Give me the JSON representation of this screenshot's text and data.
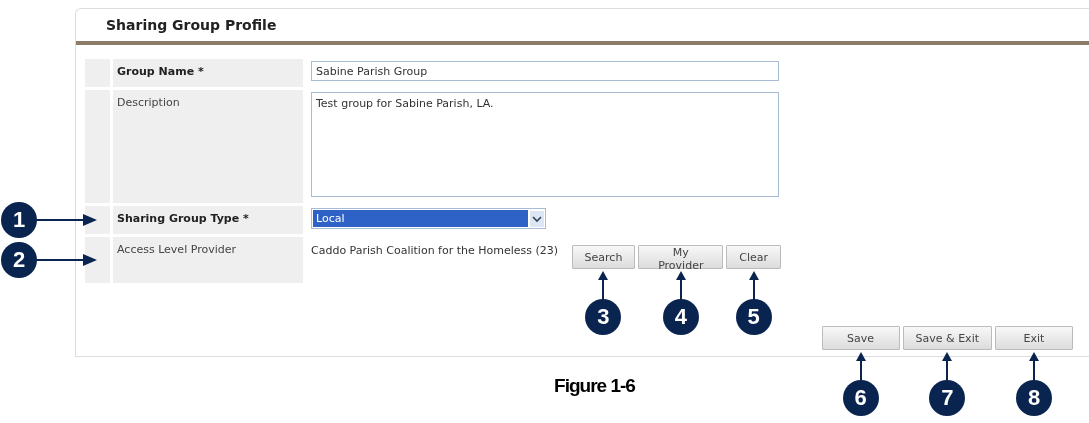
{
  "panel": {
    "title": "Sharing Group Profile"
  },
  "fields": [
    {
      "kind": "text",
      "label": "Group Name *",
      "required": true,
      "value": "Sabine Parish Group"
    },
    {
      "kind": "textarea",
      "label": "Description",
      "required": false,
      "value": "Test group for Sabine Parish, LA."
    },
    {
      "kind": "select",
      "label": "Sharing Group Type *",
      "required": true,
      "value": "Local",
      "callout": "1"
    },
    {
      "kind": "provider",
      "label": "Access Level Provider",
      "required": false,
      "value": "Caddo Parish Coalition for the Homeless (23)",
      "callout": "2",
      "buttons": [
        {
          "label": "Search",
          "callout": "3"
        },
        {
          "label": "My Provider",
          "callout": "4"
        },
        {
          "label": "Clear",
          "callout": "5"
        }
      ]
    }
  ],
  "actions": [
    {
      "label": "Save",
      "callout": "6"
    },
    {
      "label": "Save & Exit",
      "callout": "7"
    },
    {
      "label": "Exit",
      "callout": "8"
    }
  ],
  "caption": "Figure 1-6"
}
